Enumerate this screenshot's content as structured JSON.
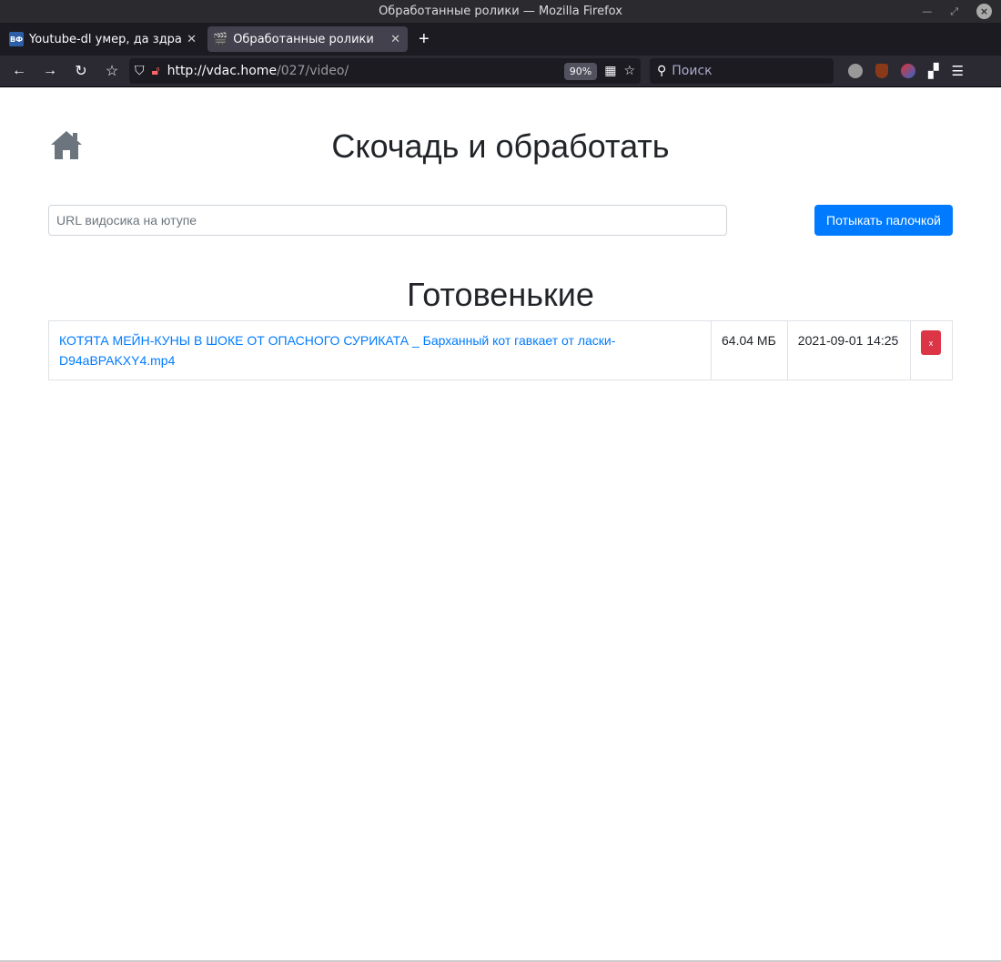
{
  "window": {
    "title": "Обработанные ролики — Mozilla Firefox"
  },
  "tabs": [
    {
      "label": "Youtube-dl умер, да здравс",
      "favicon": "ВФ"
    },
    {
      "label": "Обработанные ролики"
    }
  ],
  "navbar": {
    "url_host": "http://vdac.home",
    "url_path": "/027/video/",
    "zoom": "90%",
    "search_placeholder": "Поиск"
  },
  "page": {
    "title": "Скочадь и обработать",
    "url_placeholder": "URL видосика на ютупе",
    "submit_label": "Потыкать палочкой",
    "list_title": "Готовенькие",
    "rows": [
      {
        "name": "КОТЯТА МЕЙН-КУНЫ В ШОКЕ ОТ ОПАСНОГО СУРИКАТА _ Барханный кот гавкает от ласки-D94aBPAKXY4.mp4",
        "size": "64.04 МБ",
        "date": "2021-09-01 14:25",
        "delete_label": "x"
      }
    ]
  },
  "colors": {
    "primary": "#007bff",
    "danger": "#dc3545"
  }
}
